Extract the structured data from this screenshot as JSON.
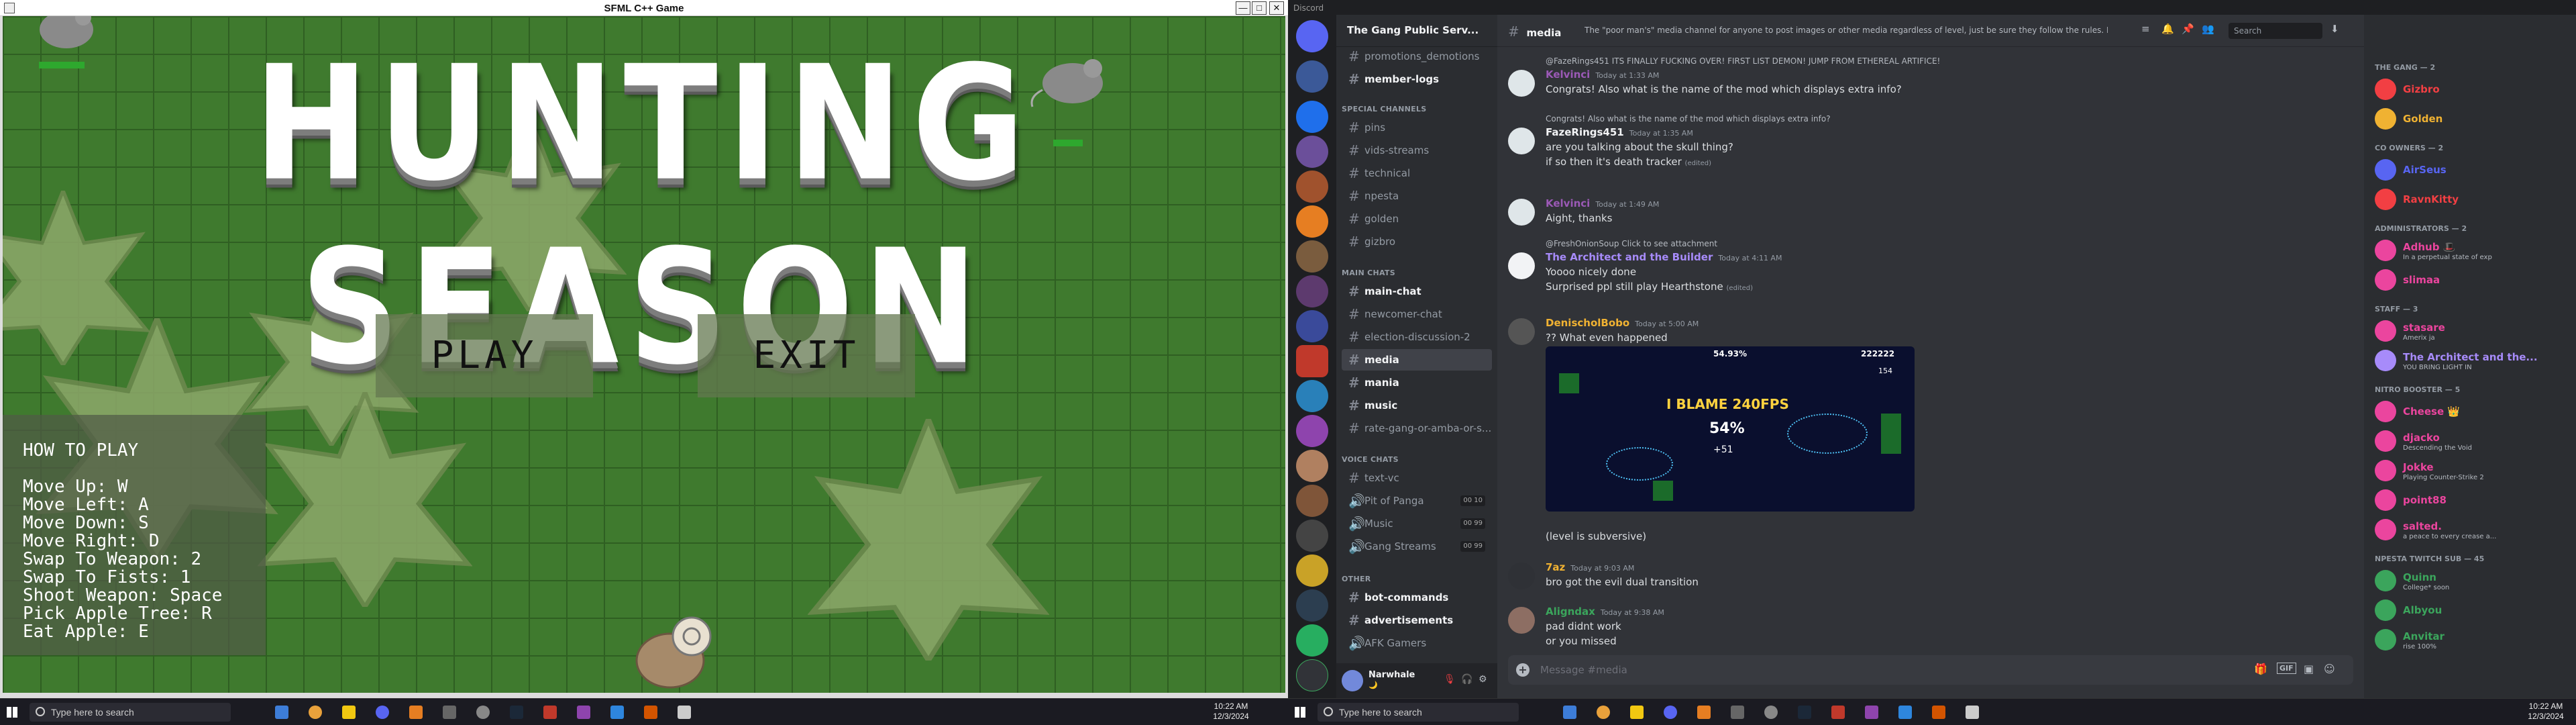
{
  "sfml": {
    "window_title": "SFML C++ Game",
    "controls": {
      "minimize": "—",
      "maximize": "□",
      "close": "✕"
    },
    "game_title": "HUNTING SEASON",
    "buttons": {
      "play": "PLAY",
      "exit": "EXIT"
    },
    "how_to_play": {
      "heading": "HOW TO PLAY",
      "lines": [
        "Move Up: W",
        "Move Left: A",
        "Move Down: S",
        "Move Right: D",
        "Swap To Weapon: 2",
        "Swap To Fists: 1",
        "Shoot Weapon: Space",
        "Pick Apple Tree: R",
        "Eat Apple: E"
      ]
    }
  },
  "taskbar_left": {
    "search_placeholder": "Type here to search",
    "time": "10:22 AM",
    "date": "12/3/2024"
  },
  "taskbar_right": {
    "search_placeholder": "Type here to search",
    "time": "10:22 AM",
    "date": "12/3/2024"
  },
  "discord": {
    "app_title": "Discord",
    "server_name": "The Gang Public Serv...",
    "channels_top": [
      {
        "name": "promotions_demotions",
        "bold": false
      },
      {
        "name": "member-logs",
        "bold": true
      }
    ],
    "special_category": "SPECIAL CHANNELS",
    "special_channels": [
      "pins",
      "vids-streams",
      "technical",
      "npesta",
      "golden",
      "gizbro"
    ],
    "main_category": "MAIN CHATS",
    "main_channels": [
      {
        "name": "main-chat",
        "bold": true,
        "active": false
      },
      {
        "name": "newcomer-chat",
        "bold": false,
        "active": false
      },
      {
        "name": "election-discussion-2",
        "bold": false,
        "active": false
      },
      {
        "name": "media",
        "bold": true,
        "active": true
      },
      {
        "name": "mania",
        "bold": true,
        "active": false
      },
      {
        "name": "music",
        "bold": true,
        "active": false
      },
      {
        "name": "rate-gang-or-amba-or-s...",
        "bold": false,
        "active": false
      }
    ],
    "voice_category": "VOICE CHATS",
    "voice_channels": [
      {
        "name": "text-vc",
        "count": ""
      },
      {
        "name": "Pit of Panga",
        "count": "00 10"
      },
      {
        "name": "Music",
        "count": "00 99"
      },
      {
        "name": "Gang Streams",
        "count": "00 99"
      }
    ],
    "other_category": "OTHER",
    "other_channels": [
      {
        "name": "bot-commands",
        "bold": true
      },
      {
        "name": "advertisements",
        "bold": true
      },
      {
        "name": "AFK Gamers",
        "bold": false
      }
    ],
    "user": {
      "name": "Narwhale",
      "status": "🌙"
    },
    "channel_header": {
      "name": "media",
      "topic": "The \"poor man's\" media channel for anyone to post images or other media regardless of level, just be sure they follow the rules. Don't advertise any content here, do that in...",
      "search_placeholder": "Search"
    },
    "messages": [
      {
        "reply": "@FazeRings451 ITS FINALLY FUCKING OVER! FIRST LIST DEMON! JUMP FROM ETHEREAL ARTIFICE!",
        "author": "Kelvinci",
        "author_color": "#9b59b6",
        "time": "Today at 1:33 AM",
        "lines": [
          "Congrats! Also what is the name of the mod which displays extra info?"
        ]
      },
      {
        "reply": "Congrats! Also what is the name of the mod which displays extra info?",
        "author": "FazeRings451",
        "author_color": "#f2f3f5",
        "time": "Today at 1:35 AM",
        "lines": [
          "are you talking about the skull thing?",
          "if so then it's death tracker"
        ],
        "edited": "(edited)"
      },
      {
        "reply": "",
        "author": "Kelvinci",
        "author_color": "#9b59b6",
        "time": "Today at 1:49 AM",
        "lines": [
          "Aight, thanks"
        ]
      },
      {
        "reply": "@FreshOnionSoup Click to see attachment",
        "author": "The Architect and the Builder",
        "author_color": "#a78bfa",
        "time": "Today at 4:11 AM",
        "lines": [
          "Yoooo nicely done",
          "Surprised ppl still play Hearthstone"
        ],
        "edited": "(edited)"
      },
      {
        "reply": "",
        "author": "DenischolBobo",
        "author_color": "#f0b232",
        "time": "Today at 5:00 AM",
        "lines": [
          "?? What even happened"
        ]
      },
      {
        "reply": "",
        "author": "",
        "author_color": "",
        "time": "",
        "lines": [
          "(level is subversive)"
        ]
      },
      {
        "reply": "",
        "author": "7az",
        "author_color": "#f0b232",
        "time": "Today at 9:03 AM",
        "lines": [
          "bro got the evil dual transition"
        ]
      },
      {
        "reply": "",
        "author": "Aligndax",
        "author_color": "#3ba55c",
        "time": "Today at 9:38 AM",
        "lines": [
          "pad didnt work",
          "or you missed"
        ]
      }
    ],
    "embed_text": {
      "percent_top": "54.93%",
      "score": "222222",
      "fps": "154",
      "banner": "I BLAME 240FPS",
      "percent": "54%",
      "plus": "+51"
    },
    "composer_placeholder": "Message #media",
    "member_groups": [
      {
        "title": "THE GANG — 2",
        "members": [
          {
            "name": "Gizbro",
            "color": "#f23f43",
            "status": ""
          },
          {
            "name": "Golden",
            "color": "#f0b232",
            "status": ""
          }
        ]
      },
      {
        "title": "CO OWNERS — 2",
        "members": [
          {
            "name": "AirSeus",
            "color": "#5865f2",
            "status": ""
          },
          {
            "name": "RavnKitty",
            "color": "#f23f43",
            "status": ""
          }
        ]
      },
      {
        "title": "ADMINISTRATORS — 2",
        "members": [
          {
            "name": "Adhub 🎩",
            "color": "#eb459e",
            "status": "In a perpetual state of exp"
          },
          {
            "name": "slimaa",
            "color": "#eb459e",
            "status": ""
          }
        ]
      },
      {
        "title": "STAFF — 3",
        "members": [
          {
            "name": "stasare",
            "color": "#eb459e",
            "status": "Amerix ja"
          },
          {
            "name": "The Architect and the...",
            "color": "#a78bfa",
            "status": "YOU BRING LIGHT IN"
          }
        ]
      },
      {
        "title": "NITRO BOOSTER — 5",
        "members": [
          {
            "name": "Cheese 👑",
            "color": "#eb459e",
            "status": ""
          },
          {
            "name": "djacko",
            "color": "#eb459e",
            "status": "Descending the Void"
          },
          {
            "name": "Jokke",
            "color": "#eb459e",
            "status": "Playing Counter-Strike 2"
          },
          {
            "name": "point88",
            "color": "#eb459e",
            "status": ""
          },
          {
            "name": "salted.",
            "color": "#eb459e",
            "status": "a peace to every crease a..."
          }
        ]
      },
      {
        "title": "NPESTA TWITCH SUB — 45",
        "members": [
          {
            "name": "Quinn",
            "color": "#3ba55c",
            "status": "College* soon"
          },
          {
            "name": "Albyou",
            "color": "#3ba55c",
            "status": ""
          },
          {
            "name": "Anvitar",
            "color": "#3ba55c",
            "status": "rise 100%"
          }
        ]
      }
    ]
  }
}
